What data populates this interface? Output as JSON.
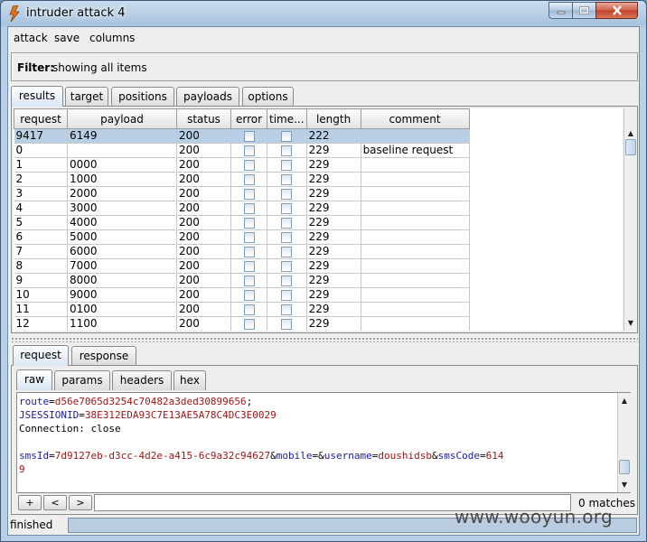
{
  "window": {
    "title": "intruder attack 4"
  },
  "menu": {
    "items": [
      "attack",
      "save",
      "columns"
    ]
  },
  "filter": {
    "label": "Filter:",
    "value": "showing all items"
  },
  "top_tabs": [
    "results",
    "target",
    "positions",
    "payloads",
    "options"
  ],
  "table": {
    "headers": [
      "request",
      "payload",
      "status",
      "error",
      "time...",
      "length",
      "comment"
    ],
    "rows": [
      [
        "9417",
        "6149",
        "200",
        "",
        "",
        "222",
        ""
      ],
      [
        "0",
        "",
        "200",
        "",
        "",
        "229",
        "baseline request"
      ],
      [
        "1",
        "0000",
        "200",
        "",
        "",
        "229",
        ""
      ],
      [
        "2",
        "1000",
        "200",
        "",
        "",
        "229",
        ""
      ],
      [
        "3",
        "2000",
        "200",
        "",
        "",
        "229",
        ""
      ],
      [
        "4",
        "3000",
        "200",
        "",
        "",
        "229",
        ""
      ],
      [
        "5",
        "4000",
        "200",
        "",
        "",
        "229",
        ""
      ],
      [
        "6",
        "5000",
        "200",
        "",
        "",
        "229",
        ""
      ],
      [
        "7",
        "6000",
        "200",
        "",
        "",
        "229",
        ""
      ],
      [
        "8",
        "7000",
        "200",
        "",
        "",
        "229",
        ""
      ],
      [
        "9",
        "8000",
        "200",
        "",
        "",
        "229",
        ""
      ],
      [
        "10",
        "9000",
        "200",
        "",
        "",
        "229",
        ""
      ],
      [
        "11",
        "0100",
        "200",
        "",
        "",
        "229",
        ""
      ],
      [
        "12",
        "1100",
        "200",
        "",
        "",
        "229",
        ""
      ]
    ],
    "selected_row": 0
  },
  "detail_tabs": [
    "request",
    "response"
  ],
  "view_tabs": [
    "raw",
    "params",
    "headers",
    "hex"
  ],
  "editor": {
    "lines": [
      [
        {
          "t": "route",
          "c": "blue"
        },
        {
          "t": "=",
          "c": "black"
        },
        {
          "t": "d56e7065d3254c70482a3ded30899656",
          "c": "red"
        },
        {
          "t": ";",
          "c": "black"
        }
      ],
      [
        {
          "t": "JSESSIONID",
          "c": "blue"
        },
        {
          "t": "=",
          "c": "black"
        },
        {
          "t": "38E312EDA93C7E13AE5A78C4DC3E0029",
          "c": "red"
        }
      ],
      [
        {
          "t": "Connection: close",
          "c": "black"
        }
      ],
      [],
      [
        {
          "t": "smsId",
          "c": "blue"
        },
        {
          "t": "=",
          "c": "black"
        },
        {
          "t": "7d9127eb-d3cc-4d2e-a415-6c9a32c94627",
          "c": "red"
        },
        {
          "t": "&",
          "c": "black"
        },
        {
          "t": "mobile",
          "c": "blue"
        },
        {
          "t": "=&",
          "c": "black"
        },
        {
          "t": "username",
          "c": "blue"
        },
        {
          "t": "=",
          "c": "black"
        },
        {
          "t": "doushidsb",
          "c": "red"
        },
        {
          "t": "&",
          "c": "black"
        },
        {
          "t": "smsCode",
          "c": "blue"
        },
        {
          "t": "=",
          "c": "black"
        },
        {
          "t": "614",
          "c": "red"
        }
      ],
      [
        {
          "t": "9",
          "c": "red"
        }
      ]
    ]
  },
  "search": {
    "buttons": [
      "+",
      "<",
      ">"
    ],
    "value": "",
    "matches": "0 matches"
  },
  "status": {
    "text": "finished"
  },
  "watermark": "www.wooyun.org",
  "colors": {
    "selected_row": "#b8cfe5",
    "key": "#1a1aa6",
    "value": "#a31515"
  }
}
